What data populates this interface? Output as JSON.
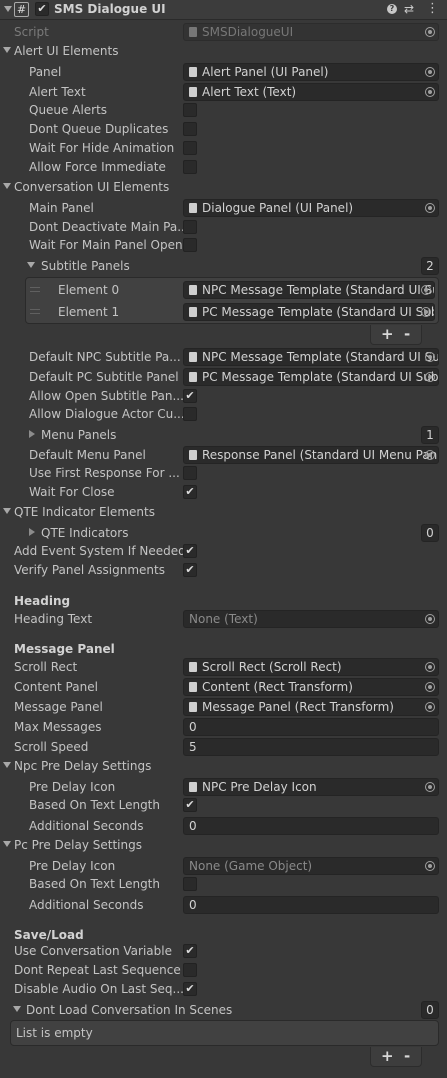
{
  "header": {
    "title": "SMS Dialogue UI",
    "enabled": true
  },
  "script": {
    "label": "Script",
    "value": "SMSDialogueUI"
  },
  "alert": {
    "title": "Alert UI Elements",
    "panel_label": "Panel",
    "panel_value": "Alert Panel (UI Panel)",
    "text_label": "Alert Text",
    "text_value": "Alert Text (Text)",
    "queue_label": "Queue Alerts",
    "dupes_label": "Dont Queue Duplicates",
    "hide_label": "Wait For Hide Animation",
    "force_label": "Allow Force Immediate"
  },
  "conversation": {
    "title": "Conversation UI Elements",
    "main_label": "Main Panel",
    "main_value": "Dialogue Panel (UI Panel)",
    "deactivate_label": "Dont Deactivate Main Pa...",
    "wait_open_label": "Wait For Main Panel Open",
    "subtitle_title": "Subtitle Panels",
    "subtitle_count": "2",
    "el0_label": "Element 0",
    "el0_value": "NPC Message Template (Standard UI Su",
    "el1_label": "Element 1",
    "el1_value": "PC Message Template (Standard UI Sub",
    "npc_sub_label": "Default NPC Subtitle Pa...",
    "npc_sub_value": "NPC Message Template (Standard UI Su",
    "pc_sub_label": "Default PC Subtitle Panel",
    "pc_sub_value": "PC Message Template (Standard UI Sub",
    "allow_open_label": "Allow Open Subtitle Pan...",
    "allow_actor_label": "Allow Dialogue Actor Cu...",
    "menu_title": "Menu Panels",
    "menu_count": "1",
    "menu_label": "Default Menu Panel",
    "menu_value": "Response Panel (Standard UI Menu Pan",
    "first_resp_label": "Use First Response For ...",
    "wait_close_label": "Wait For Close"
  },
  "qte": {
    "title": "QTE Indicator Elements",
    "indicators_title": "QTE Indicators",
    "indicators_count": "0",
    "event_label": "Add Event System If Needed",
    "verify_label": "Verify Panel Assignments"
  },
  "heading": {
    "title": "Heading",
    "text_label": "Heading Text",
    "text_value": "None (Text)"
  },
  "message": {
    "title": "Message Panel",
    "scroll_label": "Scroll Rect",
    "scroll_value": "Scroll Rect (Scroll Rect)",
    "content_label": "Content Panel",
    "content_value": "Content (Rect Transform)",
    "panel_label": "Message Panel",
    "panel_value": "Message Panel (Rect Transform)",
    "max_label": "Max Messages",
    "max_value": "0",
    "speed_label": "Scroll Speed",
    "speed_value": "5"
  },
  "npc_delay": {
    "title": "Npc Pre Delay Settings",
    "icon_label": "Pre Delay Icon",
    "icon_value": "NPC Pre Delay Icon",
    "len_label": "Based On Text Length",
    "add_label": "Additional Seconds",
    "add_value": "0"
  },
  "pc_delay": {
    "title": "Pc Pre Delay Settings",
    "icon_label": "Pre Delay Icon",
    "icon_value": "None (Game Object)",
    "len_label": "Based On Text Length",
    "add_label": "Additional Seconds",
    "add_value": "0"
  },
  "saveload": {
    "title": "Save/Load",
    "use_var_label": "Use Conversation Variable",
    "repeat_label": "Dont Repeat Last Sequence",
    "audio_label": "Disable Audio On Last Seq...",
    "scenes_title": "Dont Load Conversation In Scenes",
    "scenes_count": "0",
    "empty_text": "List is empty"
  },
  "checks": {
    "queue": false,
    "dupes": false,
    "hide": false,
    "force": false,
    "deactivate": false,
    "wait_open": false,
    "allow_open": true,
    "allow_actor": false,
    "first_resp": false,
    "wait_close": true,
    "event": true,
    "verify": true,
    "npc_len": true,
    "pc_len": false,
    "use_var": true,
    "repeat": false,
    "audio": true
  },
  "symbols": {
    "check": "✔",
    "plus": "+",
    "minus": "-"
  }
}
